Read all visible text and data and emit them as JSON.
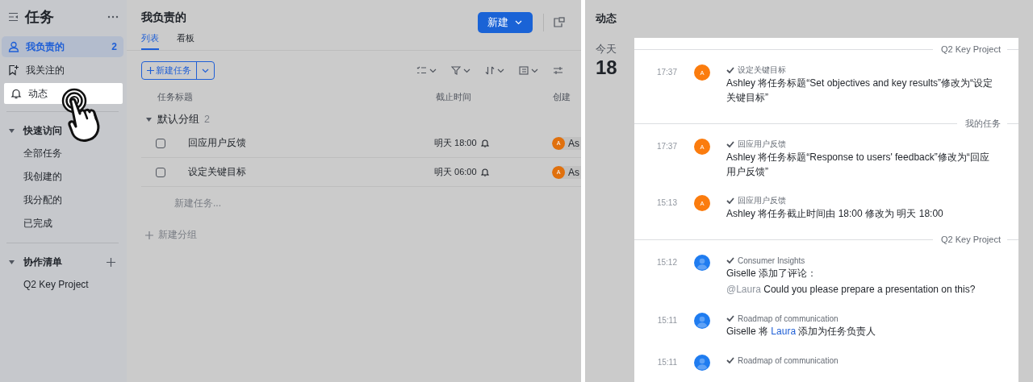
{
  "sidebar": {
    "title": "任务",
    "items": [
      {
        "label": "我负责的",
        "count": "2",
        "selected": true,
        "hovered": false
      },
      {
        "label": "我关注的",
        "selected": false,
        "hovered": false
      },
      {
        "label": "动态",
        "selected": false,
        "hovered": true
      }
    ],
    "sections": [
      {
        "title": "快速访问",
        "expanded": true,
        "addable": false,
        "items": [
          {
            "label": "全部任务"
          },
          {
            "label": "我创建的"
          },
          {
            "label": "我分配的"
          },
          {
            "label": "已完成"
          }
        ]
      },
      {
        "title": "协作清单",
        "expanded": true,
        "addable": true,
        "items": [
          {
            "label": "Q2 Key Project"
          }
        ]
      }
    ]
  },
  "main": {
    "title": "我负责的",
    "new_button": "新建",
    "tabs": [
      {
        "label": "列表",
        "selected": true
      },
      {
        "label": "看板",
        "selected": false
      }
    ],
    "new_task_button": "新建任务",
    "columns": [
      "任务标题",
      "截止时间",
      "创建"
    ],
    "group": {
      "name": "默认分组",
      "count": "2",
      "expanded": true,
      "tasks": [
        {
          "title": "回应用户反馈",
          "due": "明天 18:00",
          "reminder": true,
          "checked": false,
          "avatar": "A",
          "assignee": "As"
        },
        {
          "title": "设定关键目标",
          "due": "明天 06:00",
          "reminder": true,
          "checked": false,
          "avatar": "A",
          "assignee": "As"
        }
      ],
      "add_task_placeholder": "新建任务..."
    },
    "add_group": "新建分组"
  },
  "feed": {
    "title": "动态",
    "date": {
      "label": "今天",
      "day": "18"
    },
    "entries": [
      {
        "kind": "divider",
        "label": "Q2 Key Project"
      },
      {
        "kind": "event",
        "time": "17:37",
        "avatar": {
          "kind": "letter",
          "letter": "A"
        },
        "task": "设定关键目标",
        "segments": [
          {
            "kind": "plain",
            "text": "Ashley 将任务标题“Set objectives and key results”修改为“设定关键目标”"
          }
        ]
      },
      {
        "kind": "divider",
        "label": "我的任务"
      },
      {
        "kind": "event",
        "time": "17:37",
        "avatar": {
          "kind": "letter",
          "letter": "A"
        },
        "task": "回应用户反馈",
        "segments": [
          {
            "kind": "plain",
            "text": "Ashley 将任务标题“Response to users' feedback”修改为“回应用户反馈”"
          }
        ]
      },
      {
        "kind": "event",
        "time": "15:13",
        "avatar": {
          "kind": "letter",
          "letter": "A"
        },
        "task": "回应用户反馈",
        "segments": [
          {
            "kind": "plain",
            "text": "Ashley 将任务截止时间由 18:00 修改为 明天 18:00"
          }
        ]
      },
      {
        "kind": "divider",
        "label": "Q2 Key Project"
      },
      {
        "kind": "event",
        "time": "15:12",
        "avatar": {
          "kind": "person"
        },
        "task": "Consumer Insights",
        "segments": [
          {
            "kind": "plain",
            "text": "Giselle 添加了评论："
          }
        ],
        "comment": [
          {
            "kind": "mention",
            "text": "@Laura"
          },
          {
            "kind": "plain",
            "text": " Could you please prepare a presentation on this?"
          }
        ]
      },
      {
        "kind": "event",
        "time": "15:11",
        "avatar": {
          "kind": "person"
        },
        "task": "Roadmap of communication",
        "segments": [
          {
            "kind": "plain",
            "text": "Giselle 将 "
          },
          {
            "kind": "link",
            "text": "Laura"
          },
          {
            "kind": "plain",
            "text": " 添加为任务负责人"
          }
        ]
      },
      {
        "kind": "event",
        "time": "15:11",
        "avatar": {
          "kind": "person"
        },
        "task": "Roadmap of communication"
      }
    ]
  }
}
